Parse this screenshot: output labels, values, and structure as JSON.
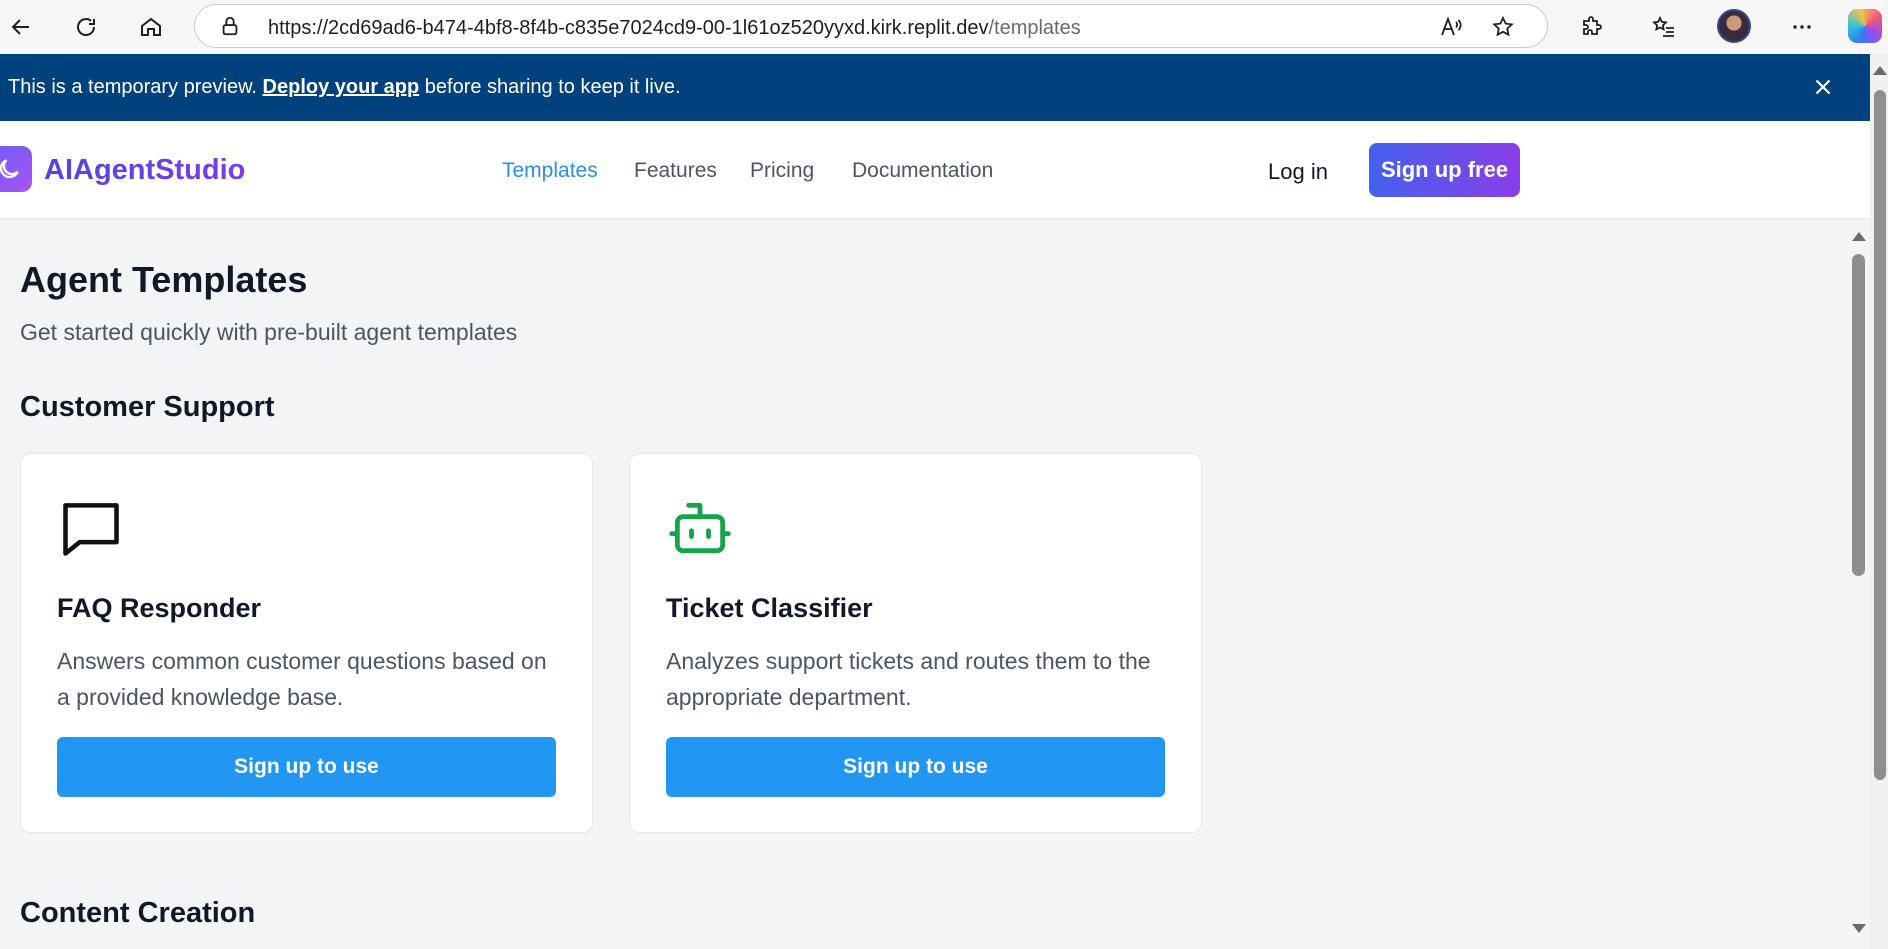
{
  "browser": {
    "url_main": "https://2cd69ad6-b474-4bf8-8f4b-c835e7024cd9-00-1l61oz520yyxd.kirk.replit.dev",
    "url_path": "/templates"
  },
  "banner": {
    "text_before": "This is a temporary preview. ",
    "link": "Deploy your app",
    "text_after": " before sharing to keep it live."
  },
  "header": {
    "logo": "AIAgentStudio",
    "nav": [
      "Templates",
      "Features",
      "Pricing",
      "Documentation"
    ],
    "active_nav": "Templates",
    "login": "Log in",
    "signup": "Sign up free"
  },
  "page": {
    "title": "Agent Templates",
    "subtitle": "Get started quickly with pre-built agent templates"
  },
  "sections": [
    {
      "title": "Customer Support",
      "cards": [
        {
          "icon": "chat-bubble-icon",
          "title": "FAQ Responder",
          "description": "Answers common customer questions based on a provided knowledge base.",
          "button": "Sign up to use"
        },
        {
          "icon": "robot-icon",
          "title": "Ticket Classifier",
          "description": "Analyzes support tickets and routes them to the appropriate department.",
          "button": "Sign up to use"
        }
      ]
    },
    {
      "title": "Content Creation",
      "cards": []
    }
  ],
  "colors": {
    "banner_bg": "#00417e",
    "accent_blue": "#2196f3",
    "nav_active": "#2b8fe8",
    "robot_green": "#16a34a"
  }
}
